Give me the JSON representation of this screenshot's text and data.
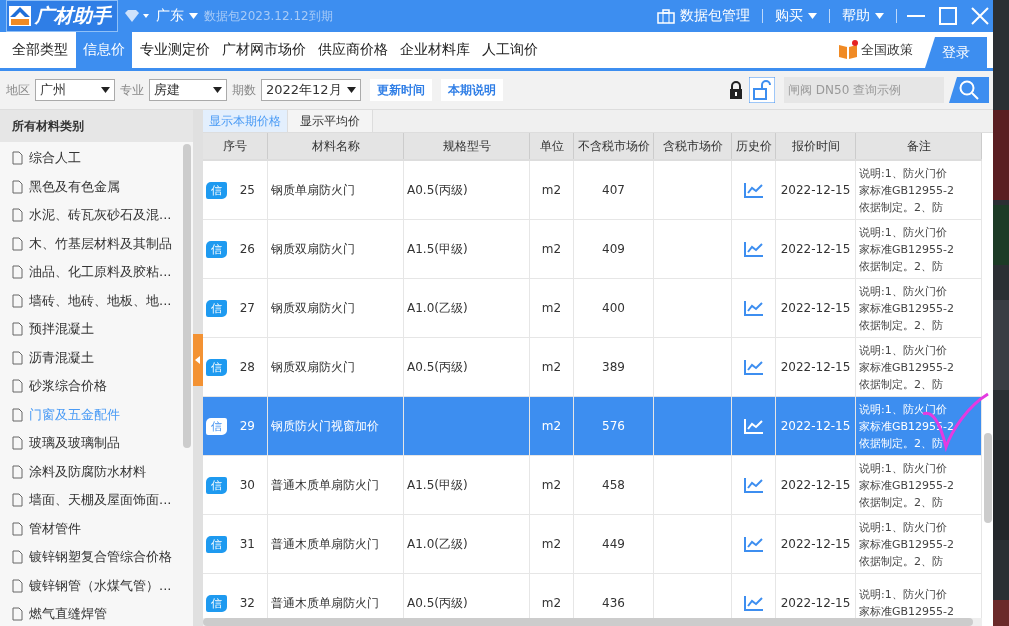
{
  "title_bar": {
    "app_name": "广材助手",
    "region": "广东",
    "expiry": "数据包2023.12.12到期",
    "package_button": "数据包管理",
    "menus": [
      "购买",
      "帮助"
    ]
  },
  "tabs": [
    {
      "label": "全部类型",
      "selected": false
    },
    {
      "label": "信息价",
      "selected": true
    },
    {
      "label": "专业测定价",
      "selected": false
    },
    {
      "label": "广材网市场价",
      "selected": false
    },
    {
      "label": "供应商价格",
      "selected": false
    },
    {
      "label": "企业材料库",
      "selected": false
    },
    {
      "label": "人工询价",
      "selected": false
    }
  ],
  "policy_link": "全国政策",
  "login_button": "登录",
  "filters": [
    {
      "label": "地区",
      "value": "广州"
    },
    {
      "label": "专业",
      "value": "房建"
    },
    {
      "label": "期数",
      "value": "2022年12月"
    }
  ],
  "filter_buttons": [
    "更新时间",
    "本期说明"
  ],
  "search": {
    "placeholder": "闸阀 DN50 查询示例"
  },
  "sidebar": {
    "title": "所有材料类别",
    "items": [
      {
        "label": "综合人工",
        "selected": false
      },
      {
        "label": "黑色及有色金属",
        "selected": false
      },
      {
        "label": "水泥、砖瓦灰砂石及混...",
        "selected": false
      },
      {
        "label": "木、竹基层材料及其制品",
        "selected": false
      },
      {
        "label": "油品、化工原料及胶粘...",
        "selected": false
      },
      {
        "label": "墙砖、地砖、地板、地...",
        "selected": false
      },
      {
        "label": "预拌混凝土",
        "selected": false
      },
      {
        "label": "沥青混凝土",
        "selected": false
      },
      {
        "label": "砂浆综合价格",
        "selected": false
      },
      {
        "label": "门窗及五金配件",
        "selected": true
      },
      {
        "label": "玻璃及玻璃制品",
        "selected": false
      },
      {
        "label": "涂料及防腐防水材料",
        "selected": false
      },
      {
        "label": "墙面、天棚及屋面饰面...",
        "selected": false
      },
      {
        "label": "管材管件",
        "selected": false
      },
      {
        "label": "镀锌钢塑复合管综合价格",
        "selected": false
      },
      {
        "label": "镀锌钢管（水煤气管）...",
        "selected": false
      },
      {
        "label": "燃气直缝焊管",
        "selected": false
      }
    ]
  },
  "view_tabs": [
    {
      "label": "显示本期价格",
      "selected": true
    },
    {
      "label": "显示平均价",
      "selected": false
    }
  ],
  "table": {
    "columns": [
      "序号",
      "材料名称",
      "规格型号",
      "单位",
      "不含税市场价",
      "含税市场价",
      "历史价",
      "报价时间",
      "备注"
    ],
    "rows": [
      {
        "badge": "信",
        "no": "25",
        "name": "钢质单扇防火门",
        "spec": "A0.5(丙级)",
        "unit": "m2",
        "price": "407",
        "date": "2022-12-15",
        "remark": [
          "说明:1、防火门价",
          "家标准GB12955-2",
          "依据制定。2、防"
        ],
        "selected": false
      },
      {
        "badge": "信",
        "no": "26",
        "name": "钢质双扇防火门",
        "spec": "A1.5(甲级)",
        "unit": "m2",
        "price": "409",
        "date": "2022-12-15",
        "remark": [
          "说明:1、防火门价",
          "家标准GB12955-2",
          "依据制定。2、防"
        ],
        "selected": false
      },
      {
        "badge": "信",
        "no": "27",
        "name": "钢质双扇防火门",
        "spec": "A1.0(乙级)",
        "unit": "m2",
        "price": "400",
        "date": "2022-12-15",
        "remark": [
          "说明:1、防火门价",
          "家标准GB12955-2",
          "依据制定。2、防"
        ],
        "selected": false
      },
      {
        "badge": "信",
        "no": "28",
        "name": "钢质双扇防火门",
        "spec": "A0.5(丙级)",
        "unit": "m2",
        "price": "389",
        "date": "2022-12-15",
        "remark": [
          "说明:1、防火门价",
          "家标准GB12955-2",
          "依据制定。2、防"
        ],
        "selected": false
      },
      {
        "badge": "信",
        "no": "29",
        "name": "钢质防火门视窗加价",
        "unit": "m2",
        "price": "576",
        "date": "2022-12-15",
        "remark": [
          "说明:1、防火门价",
          "家标准GB12955-2",
          "依据制定。2、防"
        ],
        "selected": true
      },
      {
        "badge": "信",
        "no": "30",
        "name": "普通木质单扇防火门",
        "spec": "A1.5(甲级)",
        "unit": "m2",
        "price": "458",
        "date": "2022-12-15",
        "remark": [
          "说明:1、防火门价",
          "家标准GB12955-2",
          "依据制定。2、防"
        ],
        "selected": false
      },
      {
        "badge": "信",
        "no": "31",
        "name": "普通木质单扇防火门",
        "spec": "A1.0(乙级)",
        "unit": "m2",
        "price": "449",
        "date": "2022-12-15",
        "remark": [
          "说明:1、防火门价",
          "家标准GB12955-2",
          "依据制定。2、防"
        ],
        "selected": false
      },
      {
        "badge": "信",
        "no": "32",
        "name": "普通木质单扇防火门",
        "spec": "A0.5(丙级)",
        "unit": "m2",
        "price": "436",
        "date": "2022-12-15",
        "remark": [
          "说明:1、防火门价",
          "家标准GB12955-2"
        ],
        "selected": false
      }
    ]
  }
}
